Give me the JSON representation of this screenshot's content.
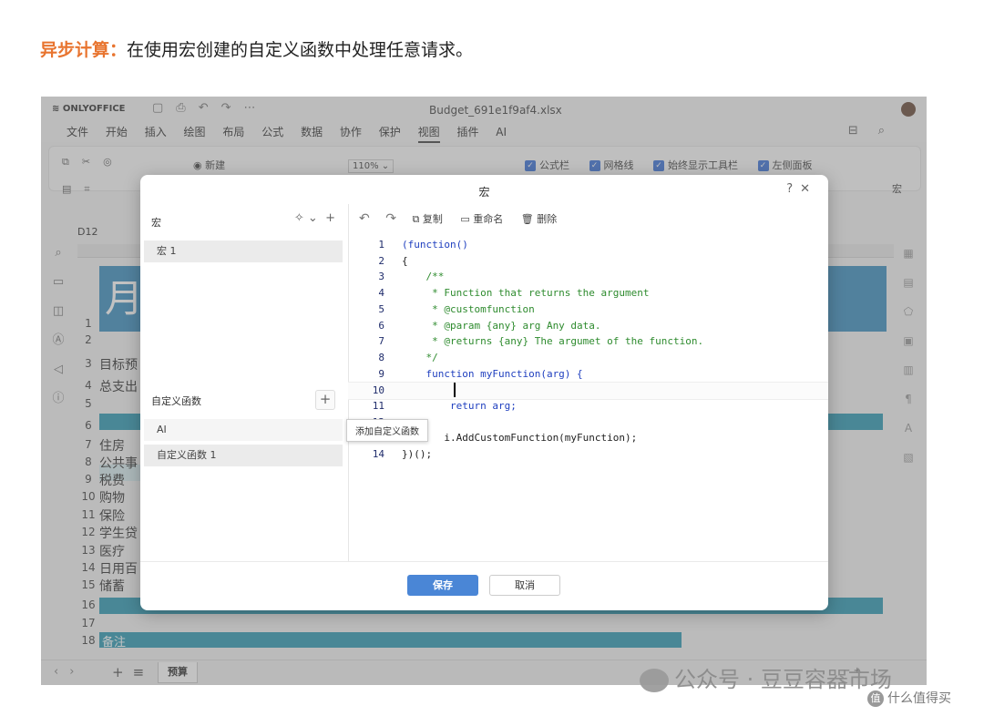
{
  "article": {
    "highlight": "异步计算：",
    "text": "在使用宏创建的自定义函数中处理任意请求。"
  },
  "app": {
    "logo": "ONLYOFFICE",
    "doc_title": "Budget_691e1f9af4.xlsx",
    "menu": [
      "文件",
      "开始",
      "插入",
      "绘图",
      "布局",
      "公式",
      "数据",
      "协作",
      "保护",
      "视图",
      "插件",
      "AI"
    ],
    "active_menu": "视图",
    "ribbon": {
      "new_label": "新建",
      "zoom": "110%",
      "checks": [
        "公式栏",
        "网格线",
        "始终显示工具栏",
        "左侧面板"
      ],
      "macro_label": "宏"
    },
    "name_box": "D12",
    "rows": [
      "1",
      "2",
      "3",
      "4",
      "5",
      "6",
      "7",
      "8",
      "9",
      "10",
      "11",
      "12",
      "13",
      "14",
      "15",
      "16",
      "17",
      "18"
    ],
    "cells": {
      "month": "月",
      "r3": "目标预",
      "r4": "总支出",
      "r7": "住房",
      "r8": "公共事",
      "r9": "税费",
      "r10": "购物",
      "r11": "保险",
      "r12": "学生贷",
      "r13": "医疗",
      "r14": "日用百",
      "r15": "储蓄",
      "r18": "备注"
    },
    "sheet_tab": "预算"
  },
  "dialog": {
    "title": "宏",
    "macros_title": "宏",
    "macros": [
      "宏 1"
    ],
    "functions_title": "自定义函数",
    "functions": [
      "AI",
      "自定义函数 1"
    ],
    "tooltip": "添加自定义函数",
    "toolbar": {
      "copy": "复制",
      "rename": "重命名",
      "delete": "删除"
    },
    "save": "保存",
    "cancel": "取消",
    "code_lines": [
      {
        "n": "1",
        "t": "(function()"
      },
      {
        "n": "2",
        "t": "{"
      },
      {
        "n": "3",
        "t": "    /**"
      },
      {
        "n": "4",
        "t": "     * Function that returns the argument"
      },
      {
        "n": "5",
        "t": "     * @customfunction"
      },
      {
        "n": "6",
        "t": "     * @param {any} arg Any data."
      },
      {
        "n": "7",
        "t": "     * @returns {any} The argumet of the function."
      },
      {
        "n": "8",
        "t": "    */"
      },
      {
        "n": "9",
        "t": "    function myFunction(arg) {"
      },
      {
        "n": "10",
        "t": ""
      },
      {
        "n": "11",
        "t": "        return arg;"
      },
      {
        "n": "12",
        "t": ""
      },
      {
        "n": "13",
        "t": "       i.AddCustomFunction(myFunction);"
      },
      {
        "n": "14",
        "t": "})();"
      }
    ]
  },
  "watermark": {
    "main": "公众号 · 豆豆容器市场",
    "sub": "什么值得买"
  }
}
